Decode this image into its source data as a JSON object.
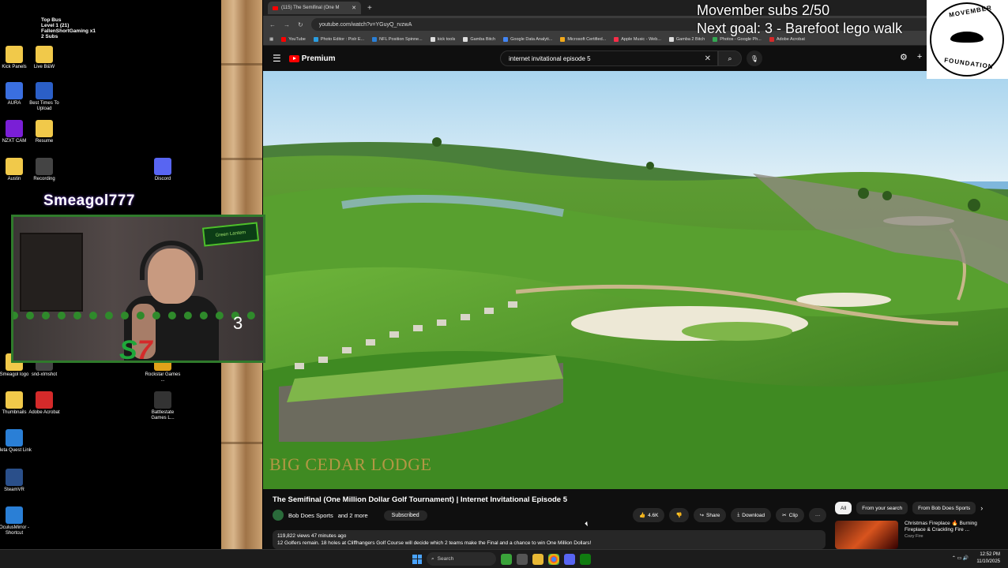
{
  "desktop": {
    "icons": [
      {
        "label": "Kick Panels",
        "color": "#f1c94a"
      },
      {
        "label": "Live B&W",
        "color": "#f1c94a"
      },
      {
        "label": "AURA",
        "color": "#3a6fe0"
      },
      {
        "label": "Best Times To Upload",
        "color": "#2b5fc7"
      },
      {
        "label": "NZXT CAM",
        "color": "#7a1fd6"
      },
      {
        "label": "Resume",
        "color": "#f1c94a"
      },
      {
        "label": "Austin",
        "color": "#f1c94a"
      },
      {
        "label": "Recording",
        "color": "#444444"
      },
      {
        "label": "Discord",
        "color": "#5865f2"
      },
      {
        "label": "Smeagol logo",
        "color": "#f1c94a"
      },
      {
        "label": "snd-xlmshot",
        "color": "#444444"
      },
      {
        "label": "Rockstar Games ...",
        "color": "#e0a21a"
      },
      {
        "label": "Thumbnails",
        "color": "#f1c94a"
      },
      {
        "label": "Adobe Acrobat",
        "color": "#d42a2a"
      },
      {
        "label": "Battlestate Games L...",
        "color": "#333333"
      },
      {
        "label": "Meta Quest Link",
        "color": "#2a7fd6"
      },
      {
        "label": "SteamVR",
        "color": "#2a4f8a"
      },
      {
        "label": "OculusMirror - Shortcut",
        "color": "#2a7fd6"
      }
    ],
    "bus_overlay": {
      "line1": "Top Bus",
      "line2": "Level 1 (21)",
      "line3": "FallenShortGaming x1",
      "line4": "2 Subs"
    }
  },
  "streamer_name": "Smeagol777",
  "cam": {
    "sign": "Green Lantern",
    "countdown": "3"
  },
  "movember": {
    "line1": "Movember subs 2/50",
    "line2": "Next goal: 3 - Barefoot lego walk",
    "logo_top": "MOVEMBER",
    "logo_bottom": "FOUNDATION"
  },
  "browser": {
    "tab_title": "(115) The Semifinal (One M",
    "url": "youtube.com/watch?v=YGuyQ_rvzwA",
    "bookmarks": [
      {
        "label": "YouTube",
        "color": "#ff0000"
      },
      {
        "label": "Photo Editor : Pixlr E...",
        "color": "#2a9de0"
      },
      {
        "label": "NFL Position Spinne...",
        "color": "#2a7fd6"
      },
      {
        "label": "kick tools",
        "color": "#dddddd"
      },
      {
        "label": "Gamba Bitch",
        "color": "#dddddd"
      },
      {
        "label": "Google Data Analyti...",
        "color": "#4285f4"
      },
      {
        "label": "Microsoft Certified...",
        "color": "#f2a91a"
      },
      {
        "label": "Apple Music - Web...",
        "color": "#fa2d48"
      },
      {
        "label": "Gamba 2 Bitch",
        "color": "#dddddd"
      },
      {
        "label": "Photos - Google Ph...",
        "color": "#34a853"
      },
      {
        "label": "Adobe Acrobat",
        "color": "#d42a2a"
      }
    ]
  },
  "youtube": {
    "brand": "Premium",
    "search_value": "internet invitational episode 5",
    "video": {
      "watermark": "BIG CEDAR LODGE",
      "title": "The Semifinal (One Million Dollar Golf Tournament) | Internet Invitational Episode 5",
      "channel": "Bob Does Sports",
      "channel_suffix": "and 2 more",
      "subscribed_label": "Subscribed",
      "likes": "4.6K",
      "share_label": "Share",
      "download_label": "Download",
      "clip_label": "Clip",
      "more_label": "···",
      "views_line": "119,822 views  47 minutes ago",
      "description": "12 Golfers remain. 18 holes at Cliffhangers Golf Course will decide which 2 teams make the Final and a chance to win One Million Dollars!"
    },
    "chips": [
      "All",
      "From your search",
      "From Bob Does Sports"
    ],
    "recommended": {
      "title": "Christmas Fireplace 🔥 Burning Fireplace & Crackling Fire ...",
      "channel": "Cozy Fire"
    }
  },
  "taskbar": {
    "search_label": "Search",
    "time": "12:52 PM",
    "date": "11/10/2025"
  }
}
